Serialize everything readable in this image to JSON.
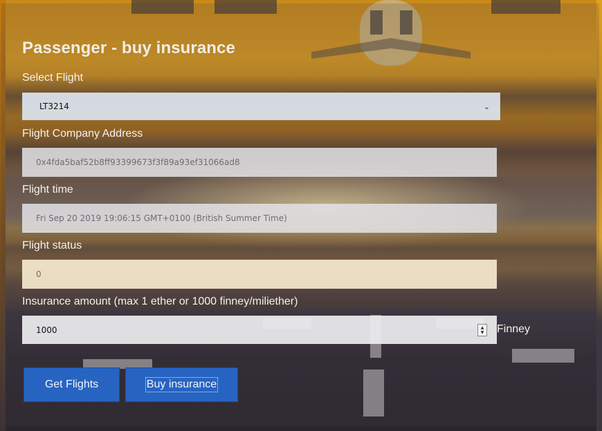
{
  "page": {
    "title": "Passenger - buy insurance"
  },
  "form": {
    "select_flight": {
      "label": "Select Flight",
      "value": "LT3214"
    },
    "company_address": {
      "label": "Flight Company Address",
      "value": "0x4fda5baf52b8ff93399673f3f89a93ef31066ad8"
    },
    "flight_time": {
      "label": "Flight time",
      "value": "Fri Sep 20 2019 19:06:15 GMT+0100 (British Summer Time)"
    },
    "flight_status": {
      "label": "Flight status",
      "value": "0"
    },
    "insurance_amount": {
      "label": "Insurance amount (max 1 ether or 1000 finney/miliether)",
      "value": "1000",
      "unit": "Finney"
    }
  },
  "buttons": {
    "get_flights": "Get Flights",
    "buy_insurance": "Buy insurance"
  },
  "colors": {
    "button": "#2764c2",
    "title": "#f2eee6"
  }
}
